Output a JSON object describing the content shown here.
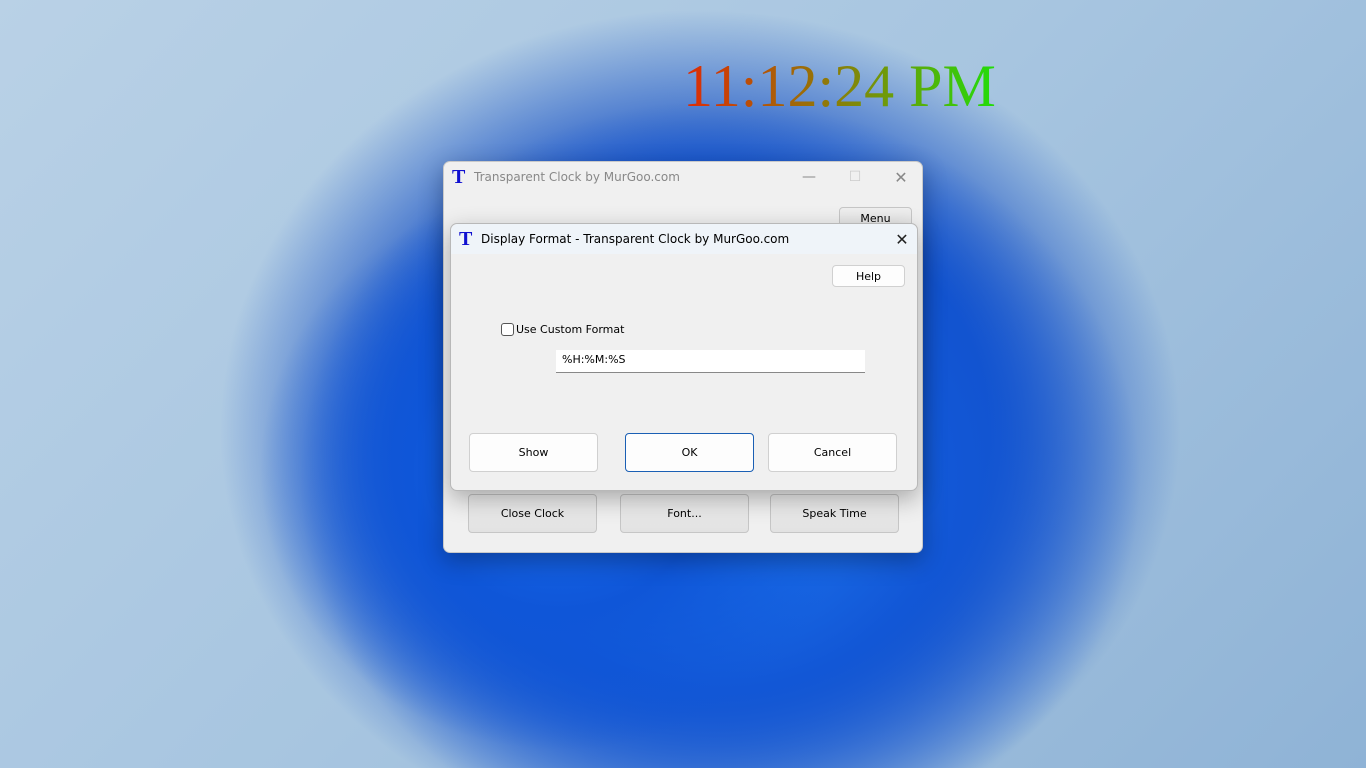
{
  "clock": {
    "time": "11:12:24 PM"
  },
  "main_window": {
    "icon": "T",
    "title": "Transparent Clock by MurGoo.com",
    "menu_label": "Menu",
    "buttons": [
      "Close Clock",
      "Font...",
      "Speak Time"
    ]
  },
  "dialog": {
    "icon": "T",
    "title": "Display Format - Transparent Clock by MurGoo.com",
    "help_label": "Help",
    "checkbox_label": "Use Custom Format",
    "checkbox_checked": false,
    "format_value": "%H:%M:%S",
    "buttons": {
      "show": "Show",
      "ok": "OK",
      "cancel": "Cancel"
    }
  }
}
